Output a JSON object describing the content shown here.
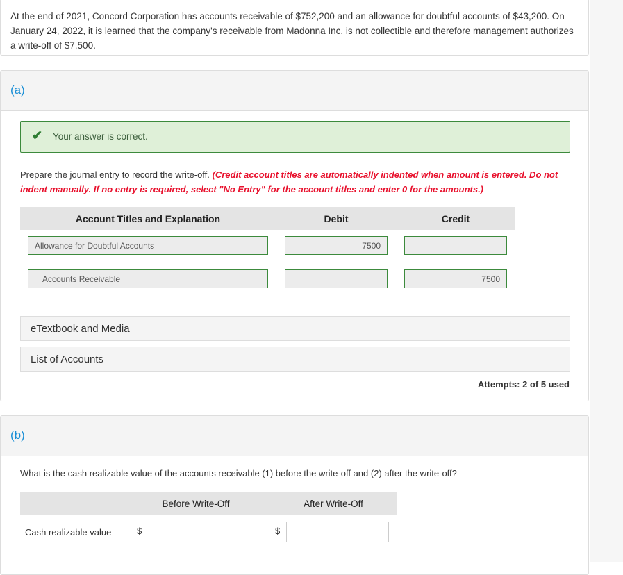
{
  "problem": {
    "text": "At the end of 2021, Concord Corporation has accounts receivable of $752,200 and an allowance for doubtful accounts of $43,200. On January 24, 2022, it is learned that the company's receivable from Madonna Inc. is not collectible and therefore management authorizes a write-off of $7,500."
  },
  "part_a": {
    "label": "(a)",
    "feedback": "Your answer is correct.",
    "instruction": "Prepare the journal entry to record the write-off. ",
    "note": "(Credit account titles are automatically indented when amount is entered. Do not indent manually. If no entry is required, select \"No Entry\" for the account titles and enter 0 for the amounts.)",
    "headers": {
      "account": "Account Titles and Explanation",
      "debit": "Debit",
      "credit": "Credit"
    },
    "rows": [
      {
        "account": "Allowance for Doubtful Accounts",
        "debit": "7500",
        "credit": ""
      },
      {
        "account": "Accounts Receivable",
        "debit": "",
        "credit": "7500"
      }
    ],
    "etextbook": "eTextbook and Media",
    "list_accounts": "List of Accounts",
    "attempts": "Attempts: 2 of 5 used"
  },
  "part_b": {
    "label": "(b)",
    "question": "What is the cash realizable value of the accounts receivable (1) before the write-off and (2) after the write-off?",
    "headers": {
      "before": "Before Write-Off",
      "after": "After Write-Off"
    },
    "row_label": "Cash realizable value",
    "currency": "$",
    "before_value": "",
    "after_value": ""
  },
  "colors": {
    "accent": "#1a8fd6",
    "correct_bg": "#dff0d8",
    "note_red": "#e8112d"
  }
}
